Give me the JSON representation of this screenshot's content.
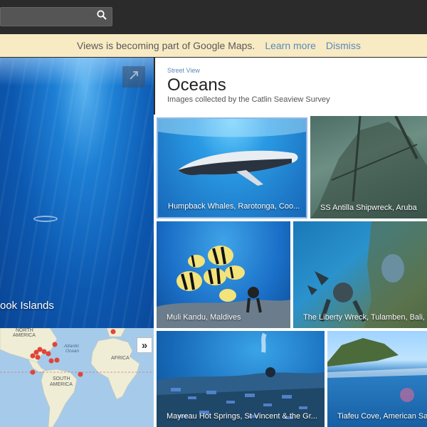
{
  "search": {
    "value": "",
    "placeholder": ""
  },
  "banner": {
    "text": "Views is becoming part of Google Maps.",
    "learn_more": "Learn more",
    "dismiss": "Dismiss"
  },
  "panorama": {
    "caption": "ook Islands"
  },
  "header": {
    "breadcrumb": "Street View",
    "title": "Oceans",
    "subtitle": "Images collected by the Catlin Seaview Survey"
  },
  "map": {
    "label_north_america": "NORTH\nAMERICA",
    "label_atlantic": "Atlantic\nOcean",
    "label_africa": "AFRICA",
    "label_south_america": "SOUTH\nAMERICA"
  },
  "tiles": [
    {
      "caption": "Humpback Whales, Rarotonga, Coo..."
    },
    {
      "caption": "SS Antilla Shipwreck, Aruba"
    },
    {
      "caption": "Muli Kandu, Maldives"
    },
    {
      "caption": "The Liberty Wreck, Tulamben, Bali, In"
    },
    {
      "caption": "Mayreau Hot Springs, St Vincent & the Gr..."
    },
    {
      "caption": "Tiafeu Cove, American Sa"
    }
  ],
  "icons": {
    "search": "search-icon",
    "expand": "expand-icon",
    "map_toggle": "double-chevron-right-icon"
  },
  "colors": {
    "topbar": "#2b2b2b",
    "banner_bg": "#f8eac3",
    "link": "#5b8ab8",
    "map_marker": "#e0443a"
  }
}
